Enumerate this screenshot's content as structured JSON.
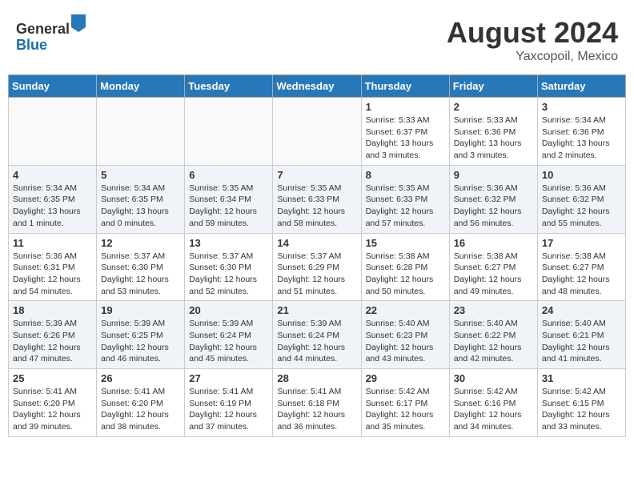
{
  "header": {
    "logo_line1": "General",
    "logo_line2": "Blue",
    "month_year": "August 2024",
    "location": "Yaxcopoil, Mexico"
  },
  "days_of_week": [
    "Sunday",
    "Monday",
    "Tuesday",
    "Wednesday",
    "Thursday",
    "Friday",
    "Saturday"
  ],
  "weeks": [
    [
      {
        "day": "",
        "info": ""
      },
      {
        "day": "",
        "info": ""
      },
      {
        "day": "",
        "info": ""
      },
      {
        "day": "",
        "info": ""
      },
      {
        "day": "1",
        "info": "Sunrise: 5:33 AM\nSunset: 6:37 PM\nDaylight: 13 hours\nand 3 minutes."
      },
      {
        "day": "2",
        "info": "Sunrise: 5:33 AM\nSunset: 6:36 PM\nDaylight: 13 hours\nand 3 minutes."
      },
      {
        "day": "3",
        "info": "Sunrise: 5:34 AM\nSunset: 6:36 PM\nDaylight: 13 hours\nand 2 minutes."
      }
    ],
    [
      {
        "day": "4",
        "info": "Sunrise: 5:34 AM\nSunset: 6:35 PM\nDaylight: 13 hours\nand 1 minute."
      },
      {
        "day": "5",
        "info": "Sunrise: 5:34 AM\nSunset: 6:35 PM\nDaylight: 13 hours\nand 0 minutes."
      },
      {
        "day": "6",
        "info": "Sunrise: 5:35 AM\nSunset: 6:34 PM\nDaylight: 12 hours\nand 59 minutes."
      },
      {
        "day": "7",
        "info": "Sunrise: 5:35 AM\nSunset: 6:33 PM\nDaylight: 12 hours\nand 58 minutes."
      },
      {
        "day": "8",
        "info": "Sunrise: 5:35 AM\nSunset: 6:33 PM\nDaylight: 12 hours\nand 57 minutes."
      },
      {
        "day": "9",
        "info": "Sunrise: 5:36 AM\nSunset: 6:32 PM\nDaylight: 12 hours\nand 56 minutes."
      },
      {
        "day": "10",
        "info": "Sunrise: 5:36 AM\nSunset: 6:32 PM\nDaylight: 12 hours\nand 55 minutes."
      }
    ],
    [
      {
        "day": "11",
        "info": "Sunrise: 5:36 AM\nSunset: 6:31 PM\nDaylight: 12 hours\nand 54 minutes."
      },
      {
        "day": "12",
        "info": "Sunrise: 5:37 AM\nSunset: 6:30 PM\nDaylight: 12 hours\nand 53 minutes."
      },
      {
        "day": "13",
        "info": "Sunrise: 5:37 AM\nSunset: 6:30 PM\nDaylight: 12 hours\nand 52 minutes."
      },
      {
        "day": "14",
        "info": "Sunrise: 5:37 AM\nSunset: 6:29 PM\nDaylight: 12 hours\nand 51 minutes."
      },
      {
        "day": "15",
        "info": "Sunrise: 5:38 AM\nSunset: 6:28 PM\nDaylight: 12 hours\nand 50 minutes."
      },
      {
        "day": "16",
        "info": "Sunrise: 5:38 AM\nSunset: 6:27 PM\nDaylight: 12 hours\nand 49 minutes."
      },
      {
        "day": "17",
        "info": "Sunrise: 5:38 AM\nSunset: 6:27 PM\nDaylight: 12 hours\nand 48 minutes."
      }
    ],
    [
      {
        "day": "18",
        "info": "Sunrise: 5:39 AM\nSunset: 6:26 PM\nDaylight: 12 hours\nand 47 minutes."
      },
      {
        "day": "19",
        "info": "Sunrise: 5:39 AM\nSunset: 6:25 PM\nDaylight: 12 hours\nand 46 minutes."
      },
      {
        "day": "20",
        "info": "Sunrise: 5:39 AM\nSunset: 6:24 PM\nDaylight: 12 hours\nand 45 minutes."
      },
      {
        "day": "21",
        "info": "Sunrise: 5:39 AM\nSunset: 6:24 PM\nDaylight: 12 hours\nand 44 minutes."
      },
      {
        "day": "22",
        "info": "Sunrise: 5:40 AM\nSunset: 6:23 PM\nDaylight: 12 hours\nand 43 minutes."
      },
      {
        "day": "23",
        "info": "Sunrise: 5:40 AM\nSunset: 6:22 PM\nDaylight: 12 hours\nand 42 minutes."
      },
      {
        "day": "24",
        "info": "Sunrise: 5:40 AM\nSunset: 6:21 PM\nDaylight: 12 hours\nand 41 minutes."
      }
    ],
    [
      {
        "day": "25",
        "info": "Sunrise: 5:41 AM\nSunset: 6:20 PM\nDaylight: 12 hours\nand 39 minutes."
      },
      {
        "day": "26",
        "info": "Sunrise: 5:41 AM\nSunset: 6:20 PM\nDaylight: 12 hours\nand 38 minutes."
      },
      {
        "day": "27",
        "info": "Sunrise: 5:41 AM\nSunset: 6:19 PM\nDaylight: 12 hours\nand 37 minutes."
      },
      {
        "day": "28",
        "info": "Sunrise: 5:41 AM\nSunset: 6:18 PM\nDaylight: 12 hours\nand 36 minutes."
      },
      {
        "day": "29",
        "info": "Sunrise: 5:42 AM\nSunset: 6:17 PM\nDaylight: 12 hours\nand 35 minutes."
      },
      {
        "day": "30",
        "info": "Sunrise: 5:42 AM\nSunset: 6:16 PM\nDaylight: 12 hours\nand 34 minutes."
      },
      {
        "day": "31",
        "info": "Sunrise: 5:42 AM\nSunset: 6:15 PM\nDaylight: 12 hours\nand 33 minutes."
      }
    ]
  ]
}
